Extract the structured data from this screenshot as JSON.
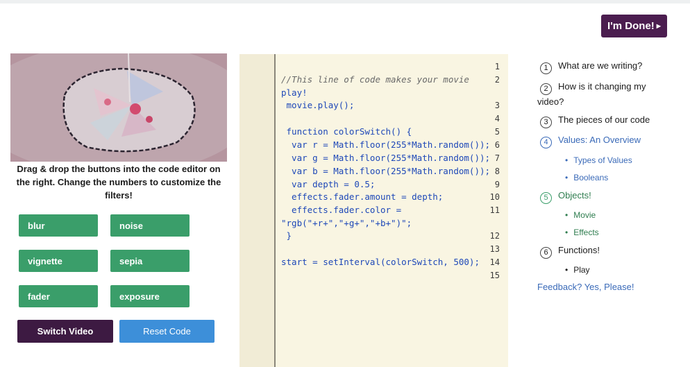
{
  "header": {
    "done_label": "I'm Done!"
  },
  "preview": {
    "instructions": "Drag & drop the buttons into the code editor on the right. Change the numbers to customize the filters!"
  },
  "filters": [
    "blur",
    "noise",
    "vignette",
    "sepia",
    "fader",
    "exposure"
  ],
  "controls": {
    "switch_label": "Switch Video",
    "reset_label": "Reset Code"
  },
  "editor": {
    "lines": [
      {
        "n": "1",
        "text": ""
      },
      {
        "n": "2",
        "text": "//This line of code makes your movie"
      },
      {
        "n": "",
        "text": "play!"
      },
      {
        "n": "3",
        "text": " movie.play();"
      },
      {
        "n": "4",
        "text": ""
      },
      {
        "n": "5",
        "text": " function colorSwitch() {"
      },
      {
        "n": "6",
        "text": "  var r = Math.floor(255*Math.random());"
      },
      {
        "n": "7",
        "text": "  var g = Math.floor(255*Math.random());"
      },
      {
        "n": "8",
        "text": "  var b = Math.floor(255*Math.random());"
      },
      {
        "n": "9",
        "text": "  var depth = 0.5;"
      },
      {
        "n": "10",
        "text": "  effects.fader.amount = depth;"
      },
      {
        "n": "11",
        "text": "  effects.fader.color ="
      },
      {
        "n": "",
        "text": "\"rgb(\"+r+\",\"+g+\",\"+b+\")\";"
      },
      {
        "n": "12",
        "text": " }"
      },
      {
        "n": "13",
        "text": ""
      },
      {
        "n": "14",
        "text": "start = setInterval(colorSwitch, 500);"
      },
      {
        "n": "15",
        "text": ""
      }
    ]
  },
  "toc": {
    "items": [
      {
        "num": "1",
        "label": "What are we writing?"
      },
      {
        "num": "2",
        "label": "How is it changing my video?"
      },
      {
        "num": "3",
        "label": "The pieces of our code"
      },
      {
        "num": "4",
        "label": "Values: An Overview"
      },
      {
        "num": "5",
        "label": "Objects!"
      },
      {
        "num": "6",
        "label": "Functions!"
      }
    ],
    "subs": [
      "Types of Values",
      "Booleans",
      "Movie",
      "Effects",
      "Play"
    ],
    "feedback": "Feedback? Yes, Please!"
  },
  "colors": {
    "accent_purple": "#4b1d4f",
    "filter_green": "#3a9e6a",
    "reset_blue": "#3d8fd9",
    "link_blue": "#3a6ab8"
  }
}
